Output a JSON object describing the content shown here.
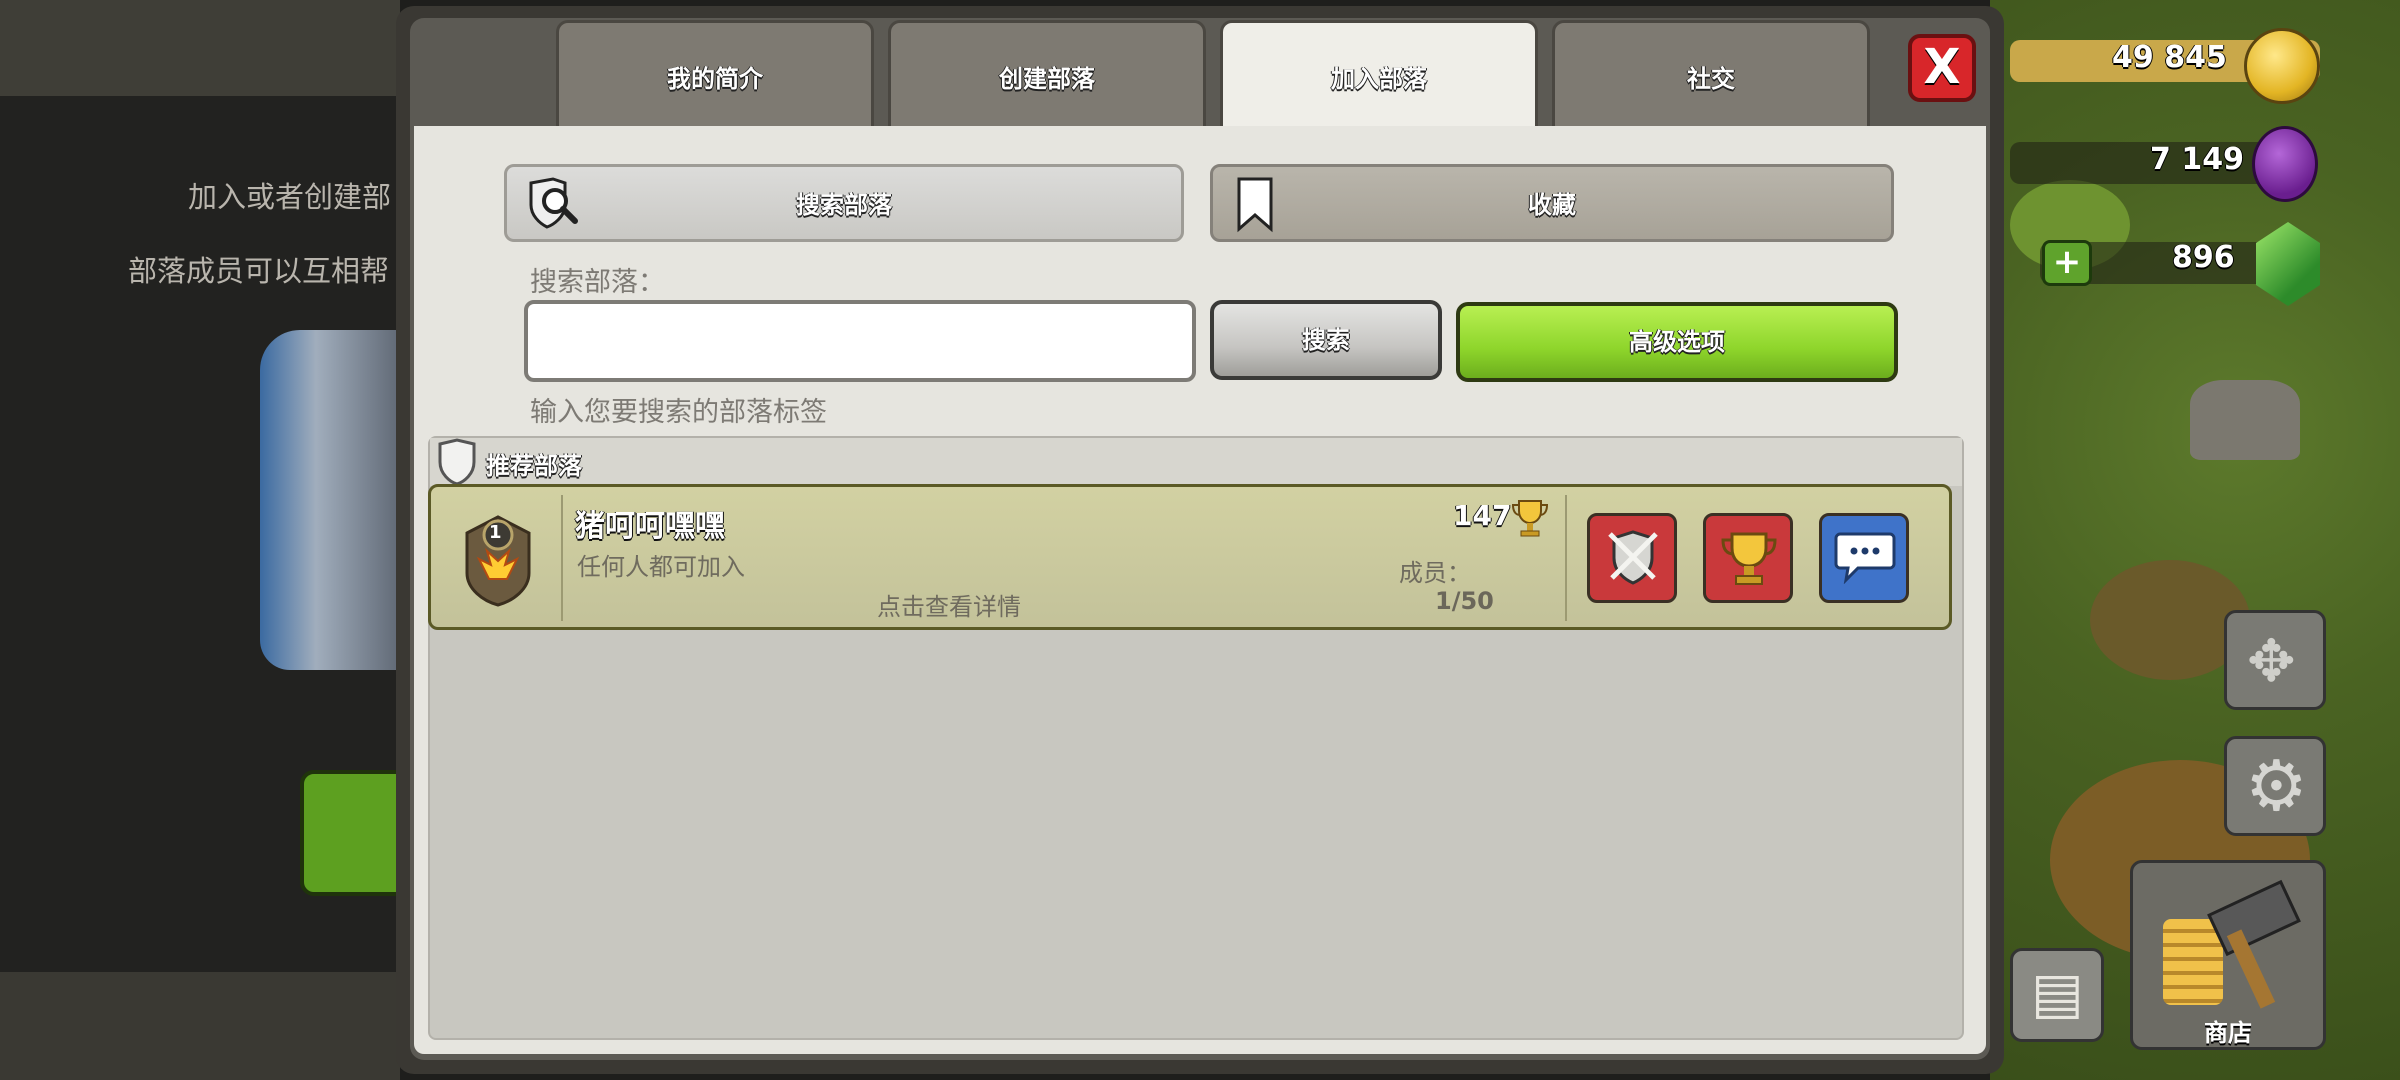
{
  "left_panel": {
    "line1": "加入或者创建部",
    "line2": "部落成员可以互相帮"
  },
  "tabs": [
    {
      "label": "我的简介"
    },
    {
      "label": "创建部落"
    },
    {
      "label": "加入部落",
      "active": true
    },
    {
      "label": "社交"
    }
  ],
  "close_label": "X",
  "actions": {
    "search_clan_label": "搜索部落",
    "favorites_label": "收藏"
  },
  "search": {
    "label": "搜索部落：",
    "value": "",
    "hint": "输入您要搜索的部落标签",
    "button_label": "搜索",
    "advanced_label": "高级选项"
  },
  "recommended": {
    "header": "推荐部落",
    "clans": [
      {
        "level": "1",
        "name": "猪呵呵嘿嘿",
        "join_type": "任何人都可加入",
        "details_hint": "点击查看详情",
        "trophies": "147",
        "members_label": "成员：",
        "members": "1/50"
      }
    ]
  },
  "hud": {
    "gold": "49 845",
    "elixir": "7 149",
    "gems": "896",
    "shop_label": "商店"
  },
  "colors": {
    "accent_green": "#8ed52b",
    "close_red": "#d8262a",
    "row_bg": "#c3c29a",
    "info_blue": "#3f73c9"
  }
}
